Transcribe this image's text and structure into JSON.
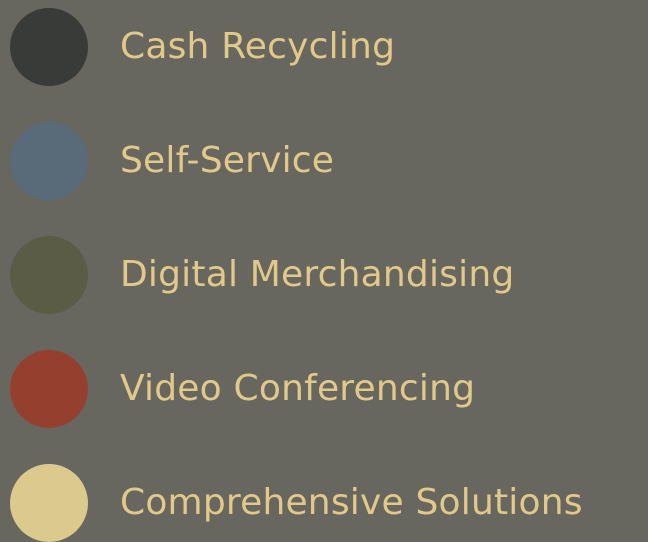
{
  "legend": {
    "items": [
      {
        "label": "Cash Recycling",
        "color": "#383b37"
      },
      {
        "label": "Self-Service",
        "color": "#596a78"
      },
      {
        "label": "Digital Merchandising",
        "color": "#5b5c46"
      },
      {
        "label": "Video Conferencing",
        "color": "#95402f"
      },
      {
        "label": "Comprehensive Solutions",
        "color": "#dcc98d"
      }
    ],
    "text_color": "#e2c98a",
    "background": "#676760"
  }
}
